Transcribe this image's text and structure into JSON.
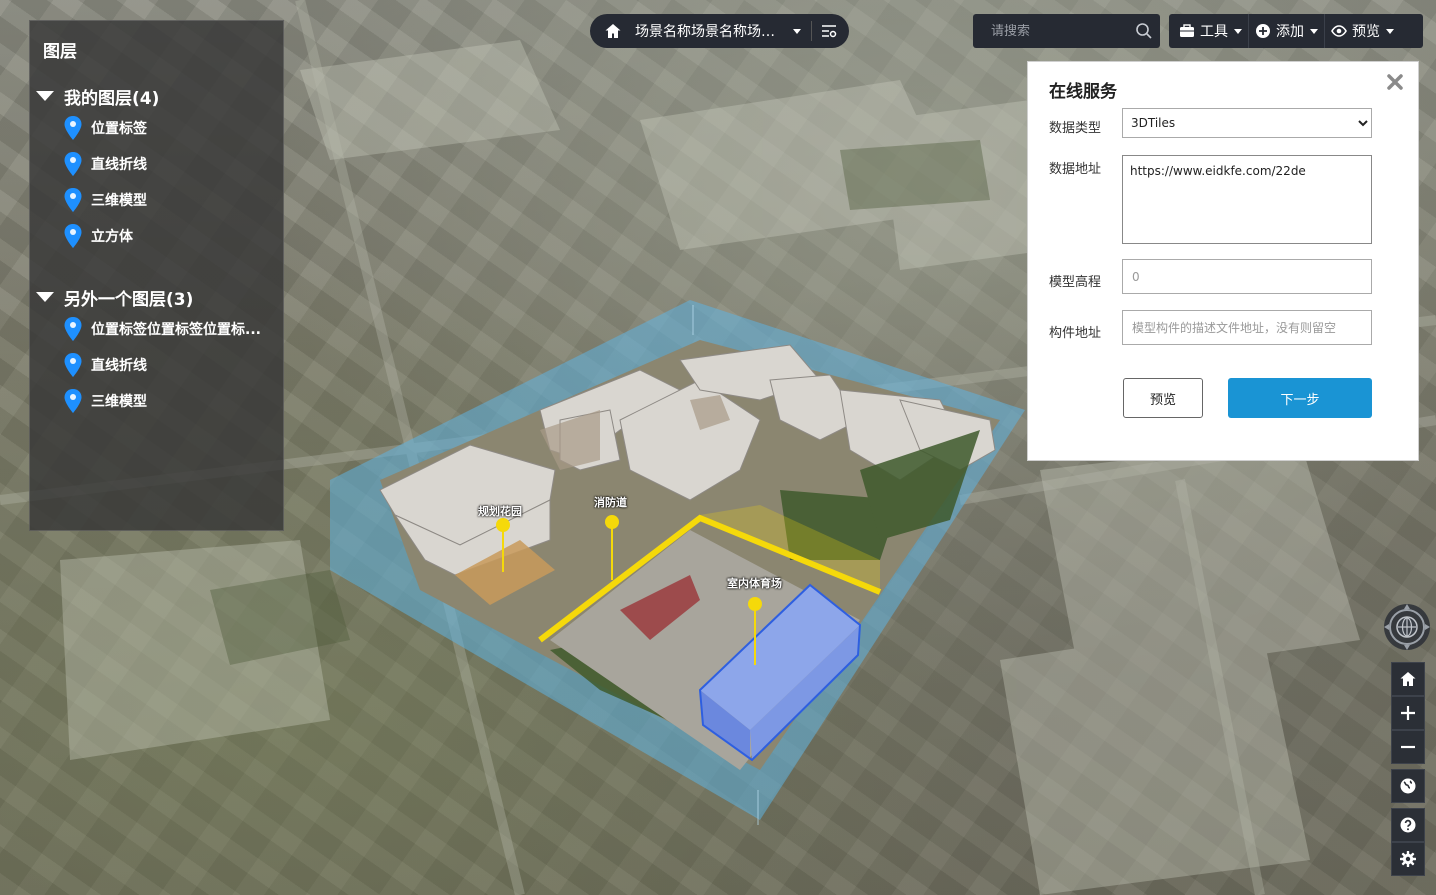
{
  "layer_panel": {
    "title": "图层",
    "groups": [
      {
        "label": "我的图层(4)",
        "items": [
          "位置标签",
          "直线折线",
          "三维模型",
          "立方体"
        ]
      },
      {
        "label": "另外一个图层(3)",
        "items": [
          "位置标签位置标签位置标...",
          "直线折线",
          "三维模型"
        ]
      }
    ]
  },
  "scene_bar": {
    "name": "场景名称场景名称场景..."
  },
  "search": {
    "placeholder": "请搜索"
  },
  "toolbar": {
    "tools": "工具",
    "add": "添加",
    "preview": "预览"
  },
  "dialog": {
    "title": "在线服务",
    "data_type_label": "数据类型",
    "data_type_value": "3DTiles",
    "data_url_label": "数据地址",
    "data_url_value": "https://www.eidkfe.com/22de",
    "height_label": "模型高程",
    "height_placeholder": "0",
    "component_label": "构件地址",
    "component_placeholder": "模型构件的描述文件地址，没有则留空",
    "preview_button": "预览",
    "next_button": "下一步"
  },
  "scene_labels": {
    "garden": "规划花园",
    "fire_lane": "消防道",
    "gym": "室内体育场"
  },
  "colors": {
    "panel_bg": "#373737",
    "toolbar_bg": "#262a33",
    "accent": "#1a94d4",
    "pin": "#1e90ff",
    "highlight": "#f5d90a",
    "model": "#7c9ae6"
  }
}
